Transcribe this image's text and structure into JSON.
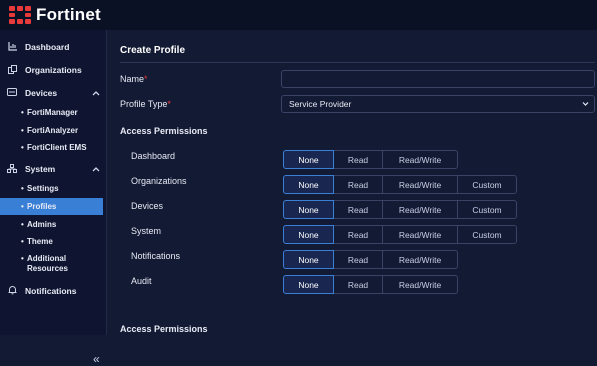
{
  "app": {
    "brand": "Fortinet"
  },
  "sidebar": {
    "items": [
      {
        "label": "Dashboard",
        "icon": "chart-icon"
      },
      {
        "label": "Organizations",
        "icon": "organizations-icon"
      },
      {
        "label": "Devices",
        "icon": "devices-icon",
        "expanded": true,
        "children": [
          "FortiManager",
          "FortiAnalyzer",
          "FortiClient EMS"
        ]
      },
      {
        "label": "System",
        "icon": "system-icon",
        "expanded": true,
        "children": [
          "Settings",
          "Profiles",
          "Admins",
          "Theme",
          "Additional Resources"
        ]
      },
      {
        "label": "Notifications",
        "icon": "bell-icon"
      }
    ],
    "active_child": "Profiles",
    "collapse_glyph": "«"
  },
  "form": {
    "title": "Create Profile",
    "name_label": "Name",
    "name_value": "",
    "profile_type_label": "Profile Type",
    "profile_type_value": "Service Provider",
    "required_mark": "*"
  },
  "access": {
    "section_title": "Access Permissions",
    "options": {
      "none": "None",
      "read": "Read",
      "read_write": "Read/Write",
      "custom": "Custom"
    },
    "rows": [
      {
        "label": "Dashboard",
        "selected": "None",
        "has_custom": false
      },
      {
        "label": "Organizations",
        "selected": "None",
        "has_custom": true
      },
      {
        "label": "Devices",
        "selected": "None",
        "has_custom": true
      },
      {
        "label": "System",
        "selected": "None",
        "has_custom": true
      },
      {
        "label": "Notifications",
        "selected": "None",
        "has_custom": false
      },
      {
        "label": "Audit",
        "selected": "None",
        "has_custom": false
      }
    ],
    "second_section_title": "Access Permissions"
  },
  "colors": {
    "accent": "#3a7fd6",
    "brand": "#e8393b",
    "background": "#131a34",
    "sidebar": "#0f1530"
  }
}
